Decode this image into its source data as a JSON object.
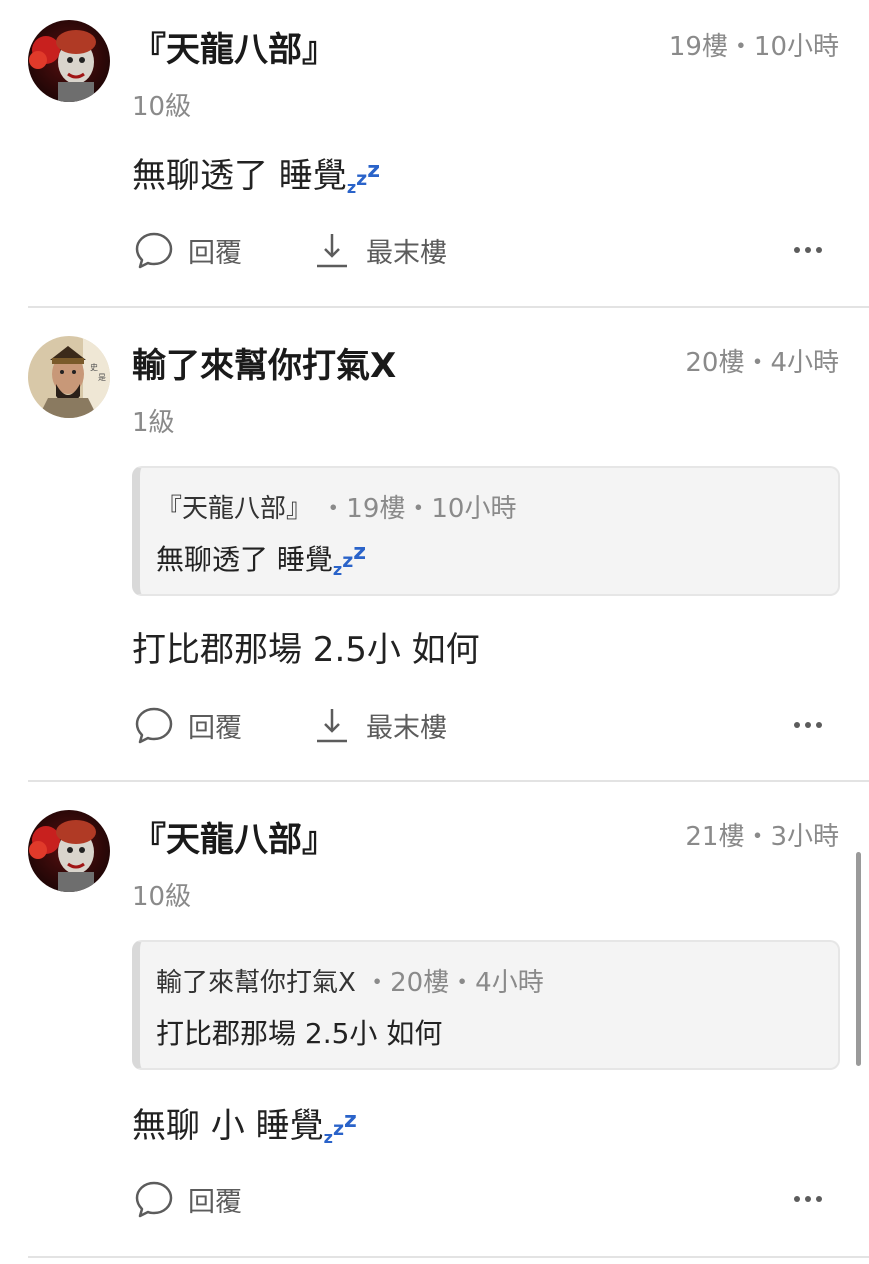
{
  "zzz": [
    "z",
    "z",
    "z"
  ],
  "posts": [
    {
      "author": "『天龍八部』",
      "meta": "19樓・10小時",
      "level": "10級",
      "content": "無聊透了 睡覺",
      "has_zzz": true,
      "quote": null,
      "actions": {
        "reply": "回覆",
        "last_floor": "最末樓"
      }
    },
    {
      "author": "輸了來幫你打氣X",
      "meta": "20樓・4小時",
      "level": "1級",
      "quote": {
        "author": "『天龍八部』",
        "meta": "・19樓・10小時",
        "content": "無聊透了 睡覺",
        "has_zzz": true
      },
      "content": "打比郡那場 2.5小 如何",
      "has_zzz": false,
      "actions": {
        "reply": "回覆",
        "last_floor": "最末樓"
      }
    },
    {
      "author": "『天龍八部』",
      "meta": "21樓・3小時",
      "level": "10級",
      "quote": {
        "author": "輸了來幫你打氣X",
        "meta": "・20樓・4小時",
        "content": "打比郡那場 2.5小 如何",
        "has_zzz": false
      },
      "content": "無聊 小 睡覺",
      "has_zzz": true,
      "actions": {
        "reply": "回覆"
      }
    }
  ],
  "colors": {
    "zzz": "#2a63c9",
    "meta": "#8a8a8a",
    "divider": "#e3e3e3",
    "quote_bg": "#f4f4f4"
  },
  "icons": [
    "speech-bubble-icon",
    "download-arrow-icon",
    "more-dots-icon"
  ]
}
